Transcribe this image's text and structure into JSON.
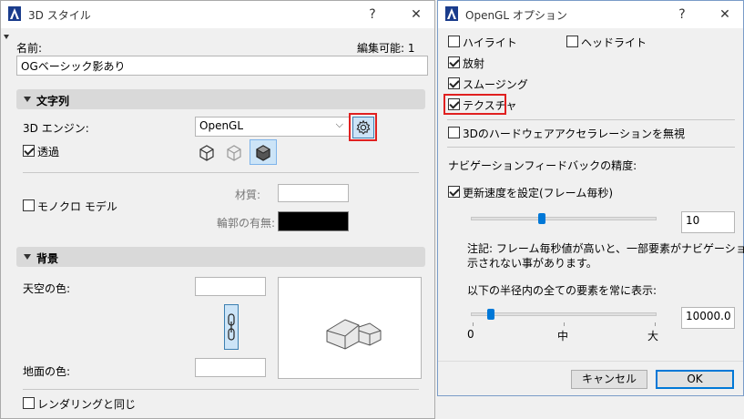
{
  "left_window": {
    "title": "3D スタイル",
    "help_glyph": "?",
    "close_glyph": "✕",
    "name_label": "名前:",
    "editable_label": "編集可能: 1",
    "name_value": "OGベーシック影あり",
    "section_text": "文字列",
    "engine_label": "3D エンジン:",
    "engine_value": "OpenGL",
    "transparency_label": "透過",
    "monochrome_label": "モノクロ モデル",
    "material_label": "材質:",
    "outline_label": "輪郭の有無:",
    "section_background": "背景",
    "sky_label": "天空の色:",
    "ground_label": "地面の色:",
    "same_as_render_label": "レンダリングと同じ",
    "outline_color": "#000000"
  },
  "right_window": {
    "title": "OpenGL オプション",
    "help_glyph": "?",
    "close_glyph": "✕",
    "highlight_label": "ハイライト",
    "headlight_label": "ヘッドライト",
    "emission_label": "放射",
    "smoothing_label": "スムージング",
    "texture_label": "テクスチャ",
    "ignore_hw_label": "3Dのハードウェアアクセラレーションを無視",
    "nav_feedback_label": "ナビゲーションフィードバックの精度:",
    "refresh_rate_label": "更新速度を設定(フレーム毎秒)",
    "refresh_rate_value": "10",
    "refresh_rate_slider": 0.38,
    "note_text_1": "注記: フレーム毎秒値が高いと、一部要素がナビゲーション中表",
    "note_text_2": "示されない事があります。",
    "radius_label": "以下の半径内の全ての要素を常に表示:",
    "radius_value": "10000.0",
    "radius_slider": 0.09,
    "scale_min": "0",
    "scale_mid": "中",
    "scale_max": "大",
    "cancel_label": "キャンセル",
    "ok_label": "OK"
  },
  "colors": {
    "accent": "#0078d7",
    "highlight_box": "#e02020"
  }
}
